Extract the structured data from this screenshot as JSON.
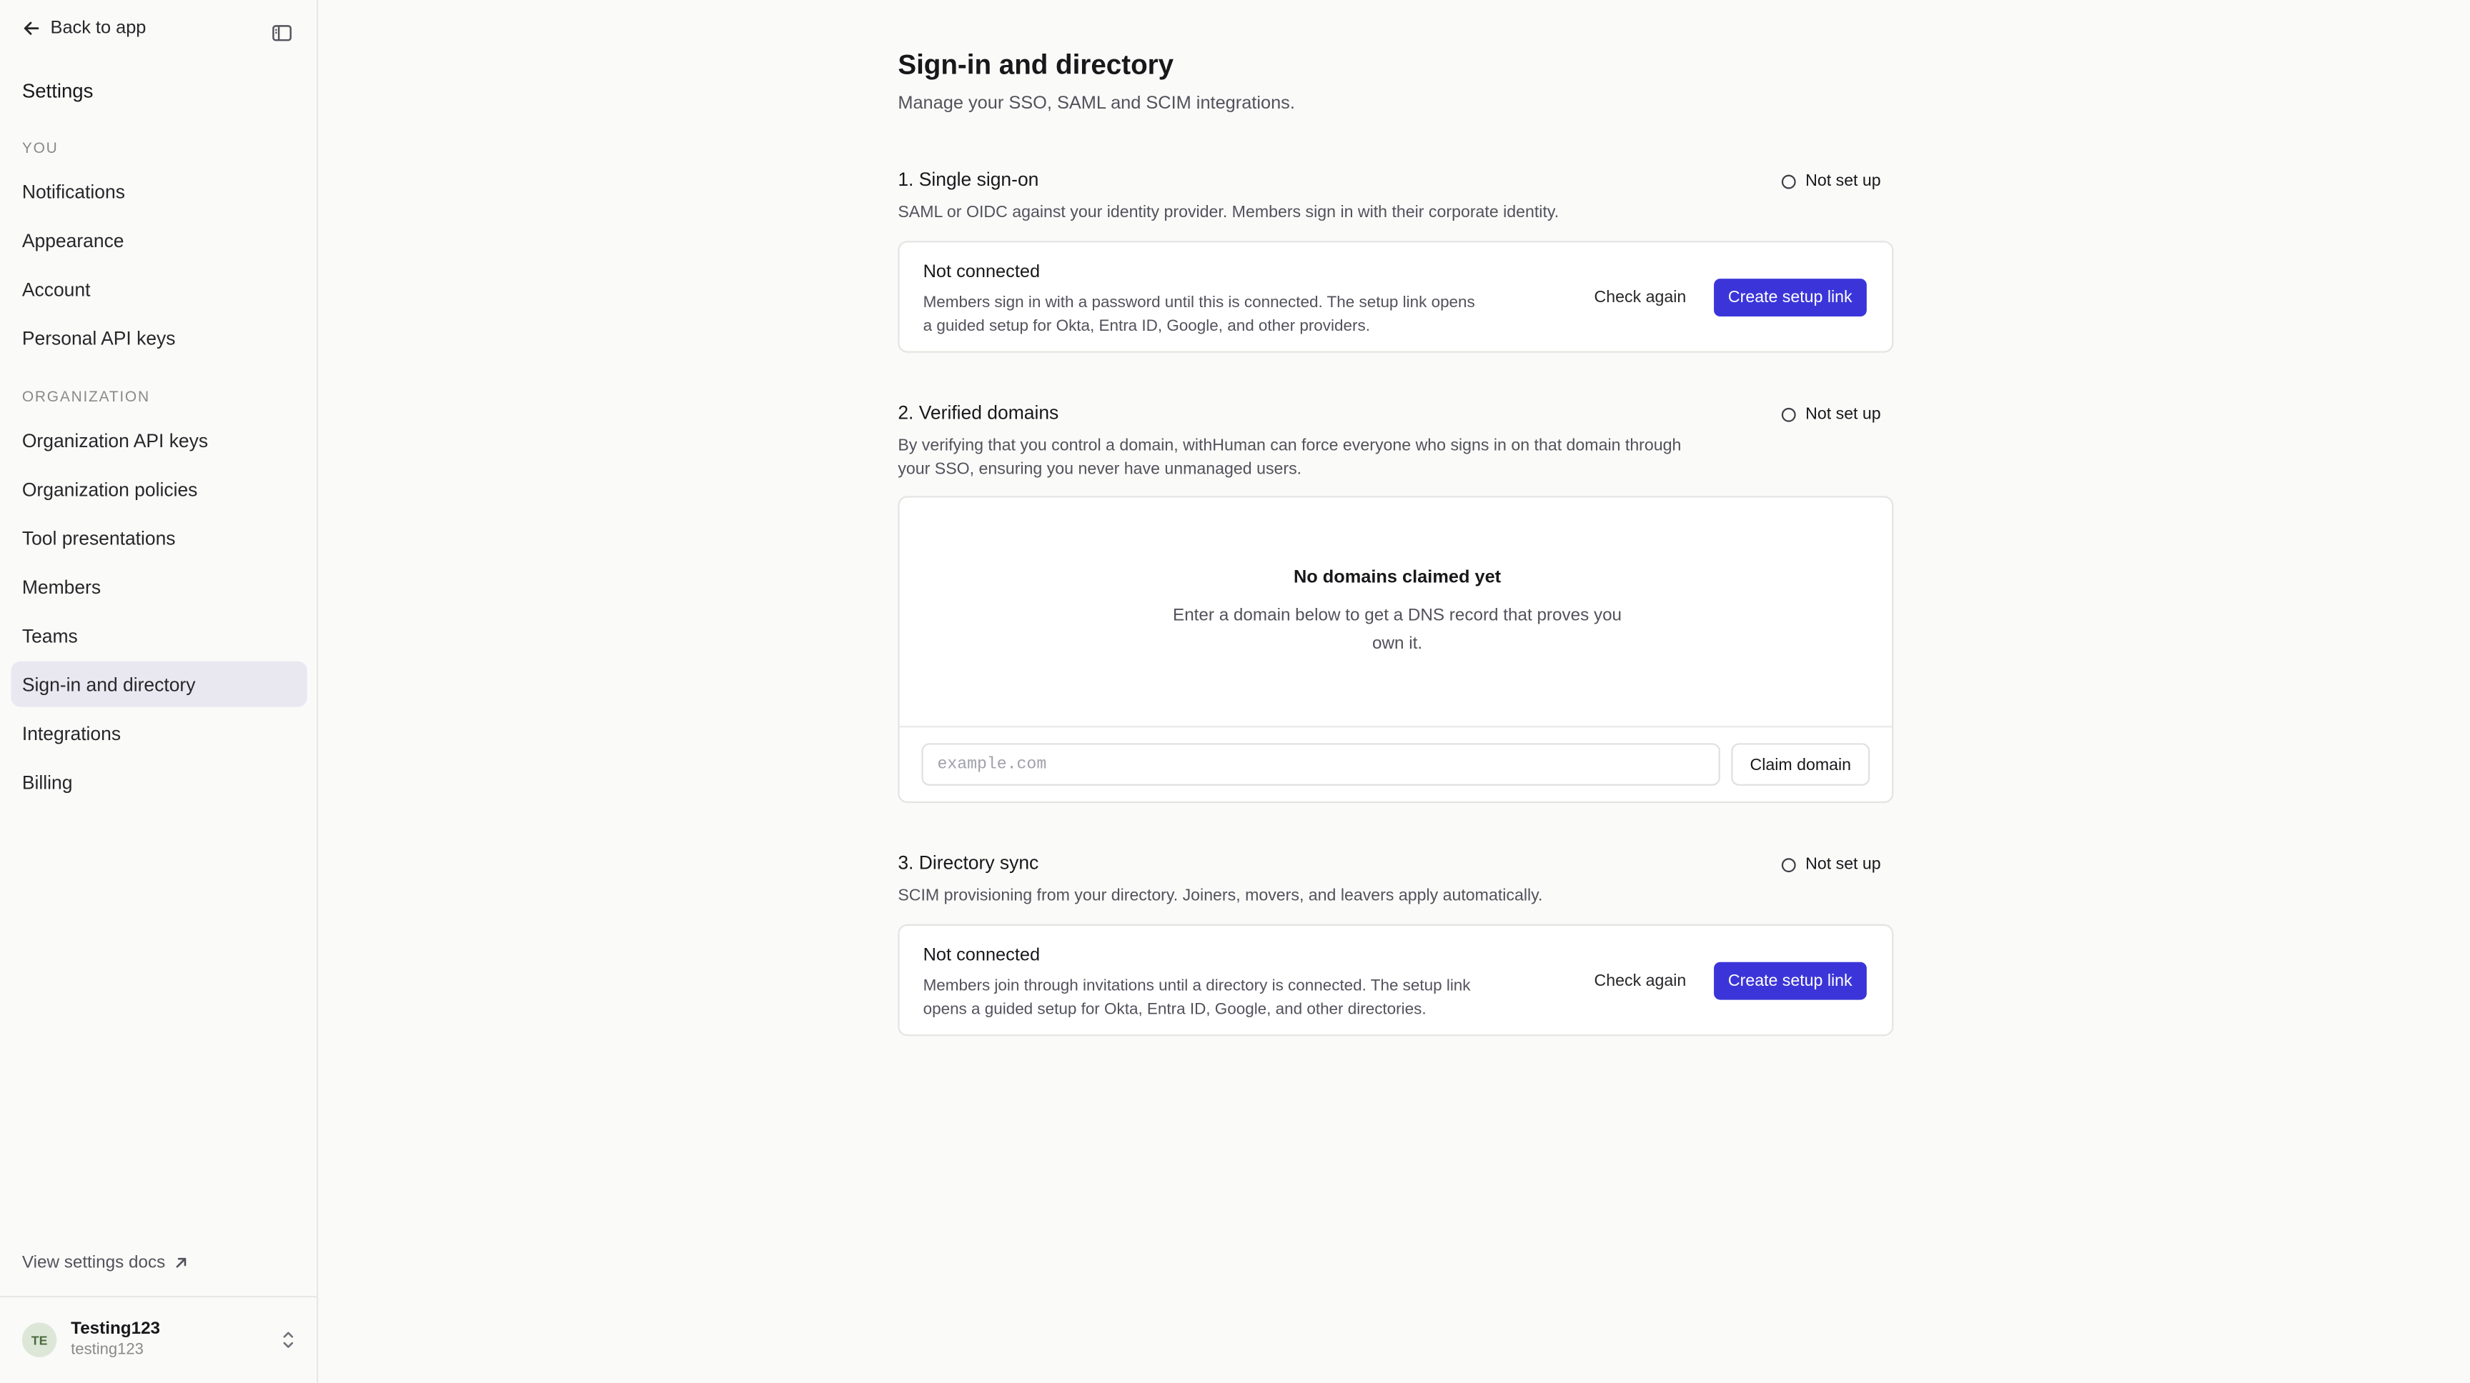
{
  "sidebar": {
    "back_label": "Back to app",
    "title": "Settings",
    "groups": [
      {
        "label": "YOU",
        "items": [
          {
            "label": "Notifications"
          },
          {
            "label": "Appearance"
          },
          {
            "label": "Account"
          },
          {
            "label": "Personal API keys"
          }
        ]
      },
      {
        "label": "ORGANIZATION",
        "items": [
          {
            "label": "Organization API keys"
          },
          {
            "label": "Organization policies"
          },
          {
            "label": "Tool presentations"
          },
          {
            "label": "Members"
          },
          {
            "label": "Teams"
          },
          {
            "label": "Sign-in and directory",
            "active": true
          },
          {
            "label": "Integrations"
          },
          {
            "label": "Billing"
          }
        ]
      }
    ],
    "docs_link": "View settings docs",
    "user": {
      "initials": "TE",
      "name": "Testing123",
      "handle": "testing123"
    }
  },
  "page": {
    "title": "Sign-in and directory",
    "subtitle": "Manage your SSO, SAML and SCIM integrations."
  },
  "sections": {
    "sso": {
      "title": "1. Single sign-on",
      "description": "SAML or OIDC against your identity provider. Members sign in with their corporate identity.",
      "status": "Not set up",
      "card_title": "Not connected",
      "card_description": "Members sign in with a password until this is connected. The setup link opens a guided setup for Okta, Entra ID, Google, and other providers.",
      "check_label": "Check again",
      "create_label": "Create setup link"
    },
    "domains": {
      "title": "2. Verified domains",
      "description": "By verifying that you control a domain, withHuman can force everyone who signs in on that domain through your SSO, ensuring you never have unmanaged users.",
      "status": "Not set up",
      "empty_title": "No domains claimed yet",
      "empty_description": "Enter a domain below to get a DNS record that proves you own it.",
      "input_placeholder": "example.com",
      "input_value": "",
      "claim_label": "Claim domain"
    },
    "directory": {
      "title": "3. Directory sync",
      "description": "SCIM provisioning from your directory. Joiners, movers, and leavers apply automatically.",
      "status": "Not set up",
      "card_title": "Not connected",
      "card_description": "Members join through invitations until a directory is connected. The setup link opens a guided setup for Okta, Entra ID, Google, and other directories.",
      "check_label": "Check again",
      "create_label": "Create setup link"
    }
  },
  "colors": {
    "accent": "#3b35d9",
    "active_nav_bg": "#e9e8f1",
    "background": "#fafaf9"
  },
  "icons": {
    "back": "arrow-left-icon",
    "collapse": "sidebar-toggle-icon",
    "external": "arrow-up-right-icon",
    "user_menu": "chevron-up-down-icon",
    "status": "circle-outline-icon"
  }
}
